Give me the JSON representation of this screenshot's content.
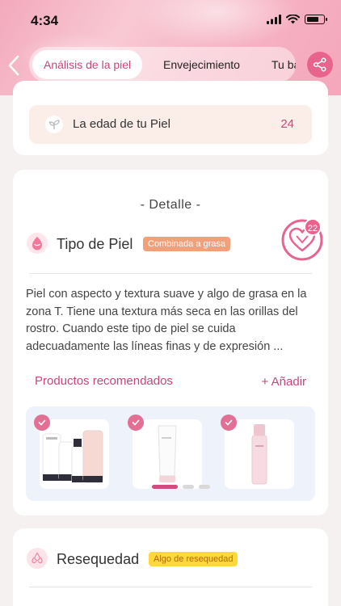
{
  "status_bar": {
    "time": "4:34",
    "battery_level": 0.75
  },
  "header": {
    "tabs": [
      {
        "label": "Análisis de la piel",
        "active": true
      },
      {
        "label": "Envejecimiento",
        "active": false
      },
      {
        "label": "Tu ba",
        "active": false
      }
    ]
  },
  "age_card": {
    "label": "La edad de tu Piel",
    "value": "24"
  },
  "detail": {
    "heading": "- Detalle -",
    "skin_type_title": "Tipo de Piel",
    "skin_type_badge": "Combinada a grasa",
    "heart_count": "22",
    "description": "Piel con aspecto y textura suave y algo de grasa en la zona T. Tiene una textura más seca en las orillas del rostro. Cuando este tipo de piel se cuida adecuadamente las líneas finas y de expresión ...",
    "recommended_label": "Productos recomendados",
    "add_label": "+ Añadir",
    "carousel_page": 1,
    "carousel_pages": 3
  },
  "dryness": {
    "title": "Resequedad",
    "badge": "Algo de resequedad"
  },
  "colors": {
    "accent": "#c8467a",
    "badge_orange": "#f2a07a",
    "badge_yellow": "#ffd93c",
    "products_bg": "#eef2fb"
  }
}
